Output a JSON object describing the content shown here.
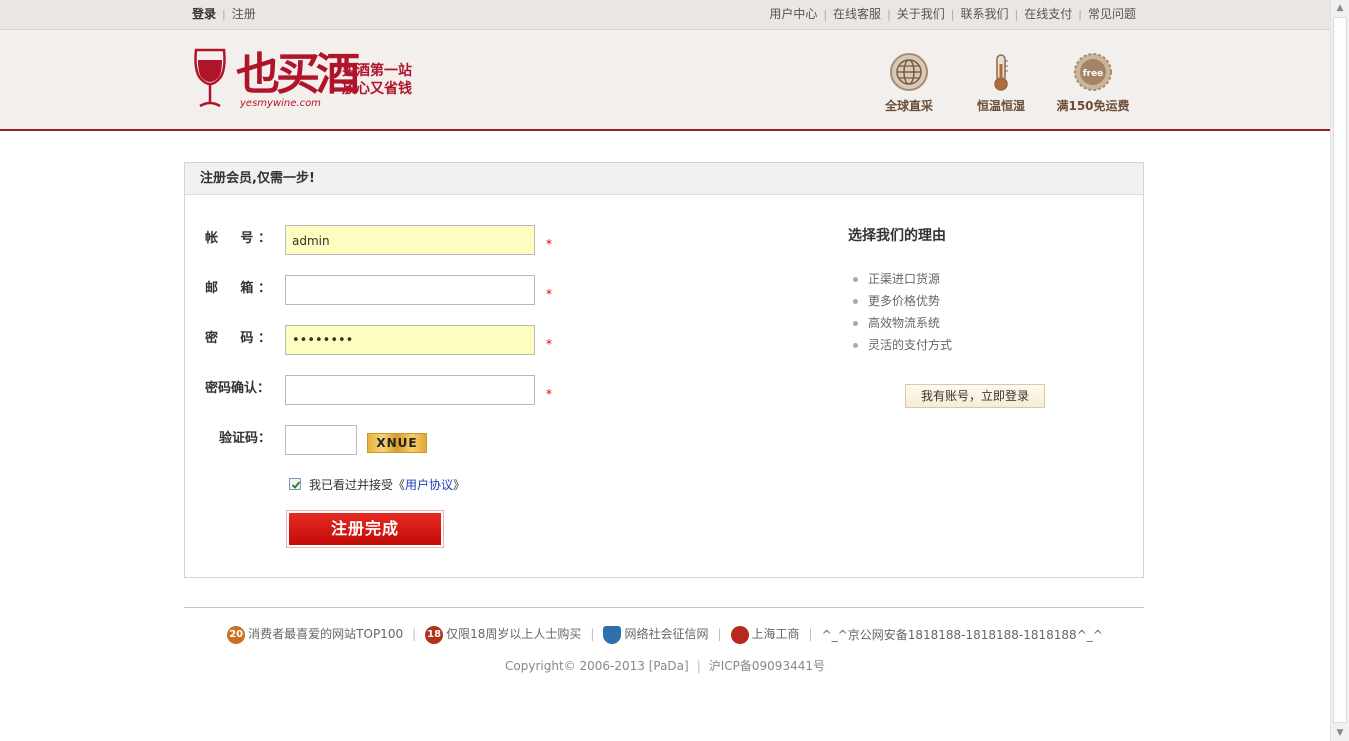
{
  "topbar": {
    "login": "登录",
    "register": "注册",
    "links": [
      "用户中心",
      "在线客服",
      "关于我们",
      "联系我们",
      "在线支付",
      "常见问题"
    ]
  },
  "header": {
    "brand": "也买酒",
    "brand_sub": "yesmywine.com",
    "slogan_line1": "买酒第一站",
    "slogan_line2": "放心又省钱",
    "features": [
      {
        "label": "全球直采",
        "icon": "globe-icon"
      },
      {
        "label": "恒温恒湿",
        "icon": "thermometer-icon"
      },
      {
        "label": "满150免运费",
        "icon": "free-badge-icon"
      }
    ],
    "badge_text": "free"
  },
  "form": {
    "title": "注册会员,仅需一步!",
    "account_label": "帐　号：",
    "account_value": "admin",
    "email_label": "邮　箱：",
    "email_value": "",
    "password_label": "密　码：",
    "password_value": "••••••••",
    "confirm_label": "密码确认：",
    "confirm_value": "",
    "captcha_label": "验证码：",
    "captcha_value": "",
    "captcha_image_text": "XNUE",
    "required_mark": "*",
    "agree_prefix": "我已看过并接受《",
    "agree_link": "用户协议",
    "agree_suffix": "》",
    "agree_checked": true,
    "submit": "注册完成"
  },
  "sidebar": {
    "title": "选择我们的理由",
    "reasons": [
      "正渠进口货源",
      "更多价格优势",
      "高效物流系统",
      "灵活的支付方式"
    ],
    "have_account": "我有账号，立即登录"
  },
  "footer": {
    "links": [
      {
        "text": "消费者最喜爱的网站TOP100",
        "badge": "20",
        "color": "#c8731f"
      },
      {
        "text": "仅限18周岁以上人士购买",
        "badge": "18",
        "color": "#b0321c"
      },
      {
        "text": "网络社会征信网",
        "badge": "",
        "color": "#2f6fae"
      },
      {
        "text": "上海工商",
        "badge": "",
        "color": "#b8281c"
      },
      {
        "text": "^_^京公网安备1818188-1818188-1818188^_^",
        "badge": null,
        "color": null
      }
    ],
    "copyright": "Copyright© 2006-2013 [PaDa]",
    "icp": "沪ICP备09093441号"
  },
  "colors": {
    "brand": "#b0142b",
    "header_border": "#9c1c28",
    "submit": "#d61a14",
    "highlight_input": "#fdfec0"
  }
}
